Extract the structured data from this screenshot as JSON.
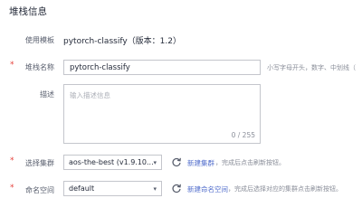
{
  "section": {
    "title": "堆栈信息"
  },
  "template": {
    "label": "使用模板",
    "value": "pytorch-classify（版本：1.2）"
  },
  "stack_name": {
    "label": "堆栈名称",
    "value": "pytorch-classify",
    "hint": "小写字母开头，数字、中划线（"
  },
  "description": {
    "label": "描述",
    "placeholder": "输入描述信息",
    "counter": "0 / 255"
  },
  "cluster": {
    "label": "选择集群",
    "value": "aos-the-best (v1.9.10...",
    "link": "新建集群",
    "note": "，完成后点击刷新按钮。"
  },
  "namespace": {
    "label": "命名空间",
    "value": "default",
    "link": "新建命名空间",
    "note": "，完成后选择对应的集群点击刷新按钮。"
  },
  "colors": {
    "accent": "#526ecc",
    "required": "#e5413b"
  }
}
